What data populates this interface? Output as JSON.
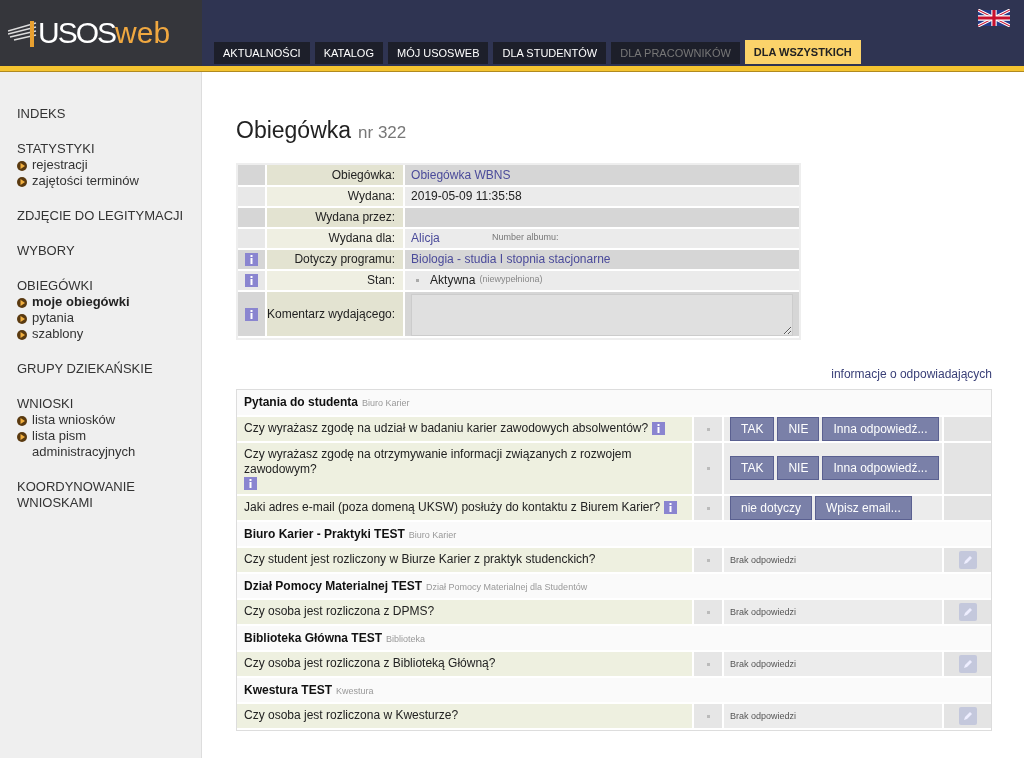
{
  "header": {
    "logo": {
      "part_1": "USOS",
      "part_2": "web"
    },
    "tabs": [
      {
        "label": "AKTUALNOŚCI",
        "selected": false,
        "disabled": false
      },
      {
        "label": "KATALOG",
        "selected": false,
        "disabled": false
      },
      {
        "label": "MÓJ USOSWEB",
        "selected": false,
        "disabled": false
      },
      {
        "label": "DLA STUDENTÓW",
        "selected": false,
        "disabled": false
      },
      {
        "label": "DLA PRACOWNIKÓW",
        "selected": false,
        "disabled": true
      },
      {
        "label": "DLA WSZYSTKICH",
        "selected": true,
        "disabled": false
      }
    ]
  },
  "sidebar": {
    "sections": [
      {
        "title": "INDEKS"
      },
      {
        "title": "STATYSTYKI",
        "items": [
          {
            "label": "rejestracji",
            "selected": false
          },
          {
            "label": "zajętości terminów",
            "selected": false
          }
        ]
      },
      {
        "title": "ZDJĘCIE DO LEGITYMACJI"
      },
      {
        "title": "WYBORY"
      },
      {
        "title": "OBIEGÓWKI",
        "items": [
          {
            "label": "moje obiegówki",
            "selected": true
          },
          {
            "label": "pytania",
            "selected": false
          },
          {
            "label": "szablony",
            "selected": false
          }
        ]
      },
      {
        "title": "GRUPY DZIEKAŃSKIE"
      },
      {
        "title": "WNIOSKI",
        "items": [
          {
            "label": "lista wniosków",
            "selected": false
          },
          {
            "label": "lista pism administracyjnych",
            "selected": false
          }
        ]
      },
      {
        "title": "KOORDYNOWANIE WNIOSKAMI"
      }
    ]
  },
  "page": {
    "title": "Obiegówka",
    "subtitle": "nr 322"
  },
  "details": [
    {
      "label": "Obiegówka:",
      "kind": "link",
      "value": "Obiegówka WBNS",
      "info": false
    },
    {
      "label": "Wydana:",
      "kind": "text",
      "value": "2019-05-09 11:35:58",
      "info": false
    },
    {
      "label": "Wydana przez:",
      "kind": "empty",
      "info": false
    },
    {
      "label": "Wydana dla:",
      "kind": "person",
      "value": "Alicja",
      "note": "Number albumu:",
      "info": false
    },
    {
      "label": "Dotyczy programu:",
      "kind": "link",
      "value": "Biologia - studia I stopnia stacjonarne",
      "info": true
    },
    {
      "label": "Stan:",
      "kind": "status",
      "value": "Aktywna",
      "note": "(niewypełniona)",
      "info": true
    },
    {
      "label": "Komentarz wydającego:",
      "kind": "textarea",
      "info": true
    }
  ],
  "responders_link": "informacje o odpowiadających",
  "groups": [
    {
      "title": "Pytania do studenta",
      "subtitle": "Biuro Karier",
      "questions": [
        {
          "text": "Czy wyrażasz zgodę na udział w badaniu karier zawodowych absolwentów?",
          "info": true,
          "kind": "buttons",
          "buttons": [
            "TAK",
            "NIE",
            "Inna odpowiedź..."
          ]
        },
        {
          "text": "Czy wyrażasz zgodę na otrzymywanie informacji związanych z rozwojem zawodowym?",
          "info": true,
          "kind": "buttons",
          "buttons": [
            "TAK",
            "NIE",
            "Inna odpowiedź..."
          ]
        },
        {
          "text": "Jaki adres e-mail (poza domeną UKSW) posłuży do kontaktu z Biurem Karier?",
          "info": true,
          "kind": "buttons",
          "buttons": [
            "nie dotyczy",
            "Wpisz email..."
          ]
        }
      ]
    },
    {
      "title": "Biuro Karier - Praktyki TEST",
      "subtitle": "Biuro Karier",
      "questions": [
        {
          "text": "Czy student jest rozliczony w Biurze Karier z praktyk studenckich?",
          "info": false,
          "kind": "status",
          "status": "Brak odpowiedzi"
        }
      ]
    },
    {
      "title": "Dział Pomocy Materialnej TEST",
      "subtitle": "Dział Pomocy Materialnej dla Studentów",
      "questions": [
        {
          "text": "Czy osoba jest rozliczona z DPMS?",
          "info": false,
          "kind": "status",
          "status": "Brak odpowiedzi"
        }
      ]
    },
    {
      "title": "Biblioteka Główna TEST",
      "subtitle": "Biblioteka",
      "questions": [
        {
          "text": "Czy osoba jest rozliczona z Biblioteką Główną?",
          "info": false,
          "kind": "status",
          "status": "Brak odpowiedzi"
        }
      ]
    },
    {
      "title": "Kwestura TEST",
      "subtitle": "Kwestura",
      "questions": [
        {
          "text": "Czy osoba jest rozliczona w Kwesturze?",
          "info": false,
          "kind": "status",
          "status": "Brak odpowiedzi"
        }
      ]
    }
  ]
}
